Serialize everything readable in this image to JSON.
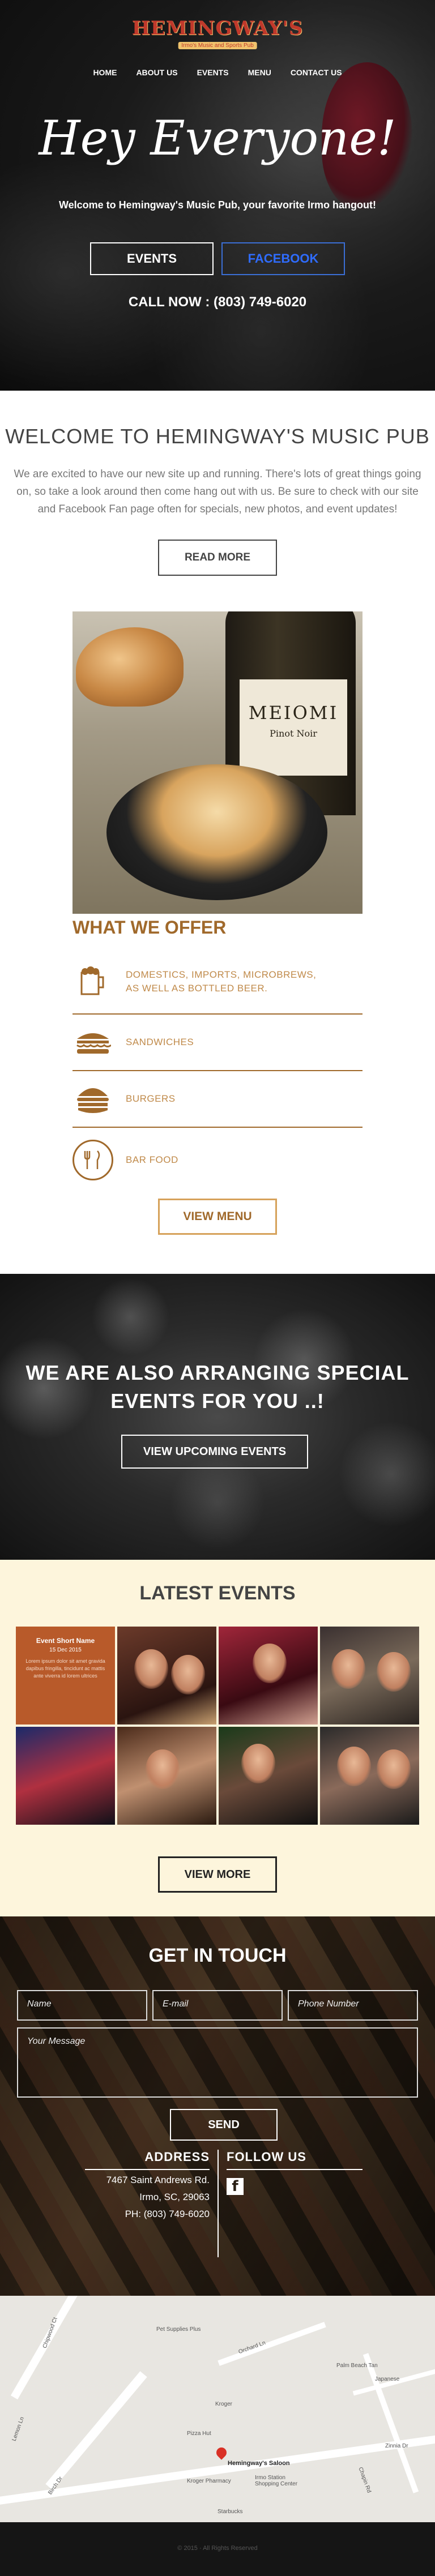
{
  "brand": {
    "name": "HEMINGWAY'S",
    "subtitle": "Irmo's Music and Sports Pub"
  },
  "nav": [
    "HOME",
    "ABOUT US",
    "EVENTS",
    "MENU",
    "CONTACT US"
  ],
  "hero": {
    "heading": "Hey Everyone!",
    "tagline": "Welcome to Hemingway's Music Pub, your favorite Irmo hangout!",
    "events_button": "EVENTS",
    "facebook_button": "FACEBOOK",
    "call_now": "CALL NOW : (803) 749-6020"
  },
  "welcome": {
    "title": "WELCOME TO HEMINGWAY'S MUSIC PUB",
    "body": "We are excited to have our new site up and running. There's lots of great things going on, so take a look around then come hang out with us. Be sure to check with our site and Facebook Fan page often for specials, new photos, and event updates!",
    "read_more": "READ MORE"
  },
  "food_image": {
    "wine_label_1": "MEIOMI",
    "wine_label_2": "Pinot Noir"
  },
  "offer": {
    "title": "WHAT WE OFFER",
    "items": [
      {
        "label_line1": "DOMESTICS, IMPORTS, MICROBREWS,",
        "label_line2": "AS WELL AS BOTTLED BEER.",
        "icon": "beer-mug-icon"
      },
      {
        "label_line1": "SANDWICHES",
        "label_line2": "",
        "icon": "sandwich-icon"
      },
      {
        "label_line1": "BURGERS",
        "label_line2": "",
        "icon": "burger-icon"
      },
      {
        "label_line1": "BAR FOOD",
        "label_line2": "",
        "icon": "utensils-icon"
      }
    ],
    "view_menu": "VIEW MENU"
  },
  "events_banner": {
    "line1": "WE ARE ALSO ARRANGING SPECIAL",
    "line2": "EVENTS FOR YOU ..!",
    "button": "VIEW UPCOMING EVENTS"
  },
  "latest_events": {
    "title": "LATEST EVENTS",
    "featured": {
      "title": "Event Short Name",
      "date": "15 Dec 2015",
      "text": "Lorem ipsum dolor sit amet gravida dapibus fringilla, tincidunt ac mattis ante viverra id lorem ultrices"
    },
    "view_more": "VIEW MORE"
  },
  "contact": {
    "title": "GET IN TOUCH",
    "name_placeholder": "Name",
    "email_placeholder": "E-mail",
    "phone_placeholder": "Phone Number",
    "message_placeholder": "Your Message",
    "send": "SEND",
    "address_heading": "ADDRESS",
    "address_line1": "7467 Saint Andrews Rd.",
    "address_line2": "Irmo, SC, 29063",
    "phone": "PH: (803) 749-6020",
    "follow_heading": "FOLLOW US",
    "facebook_icon": "facebook-icon"
  },
  "map": {
    "labels": [
      "Pet Supplies Plus",
      "Kroger",
      "Pizza Hut",
      "Hemingway's Saloon",
      "Kroger Pharmacy",
      "Irmo Station Shopping Center",
      "Starbucks",
      "Palm Beach Tan",
      "Japanese",
      "Zinnia Dr",
      "Chipwood Ct",
      "Birch Dr",
      "Lemon Ln",
      "Orchard Ln",
      "Chapin Rd"
    ]
  },
  "footer": {
    "copyright": "© 2015 · All Rights Reserved"
  },
  "colors": {
    "brown": "#a0692b",
    "facebook_blue": "#2f6cff",
    "cream": "#fdf5dc"
  }
}
